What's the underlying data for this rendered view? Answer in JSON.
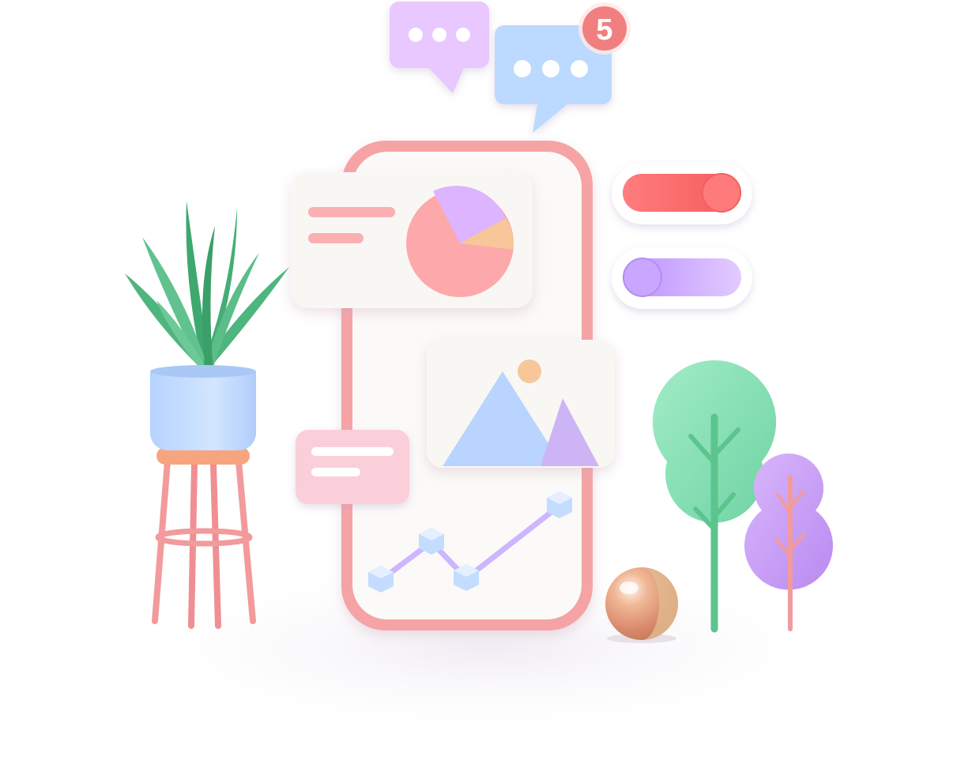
{
  "notification": {
    "count": "5"
  },
  "colors": {
    "phone_frame": "#f6a3a6",
    "screen": "#fbfaf8",
    "card": "#f9f7f4",
    "pie_main": "#fda8aa",
    "pie_purple": "#dcb4ff",
    "pie_orange": "#f7c79a",
    "bubble_purple": "#e9c7ff",
    "bubble_blue": "#bcd9ff",
    "badge": "#f27f7f",
    "toggle_red": "#f96a6a",
    "toggle_purple": "#c9a6ff",
    "plant_leaf": "#4fb57f",
    "pot": "#c4dcff",
    "stool": "#f29a9c",
    "tree_green": "#8ee3b8",
    "tree_purple": "#c99ef6",
    "sphere": "#e7a582"
  },
  "icons": [
    "chat-bubble-icon",
    "notification-badge-icon",
    "pie-chart-icon",
    "image-placeholder-icon",
    "line-chart-icon",
    "toggle-icon",
    "plant-icon",
    "tree-icon",
    "sphere-icon"
  ]
}
